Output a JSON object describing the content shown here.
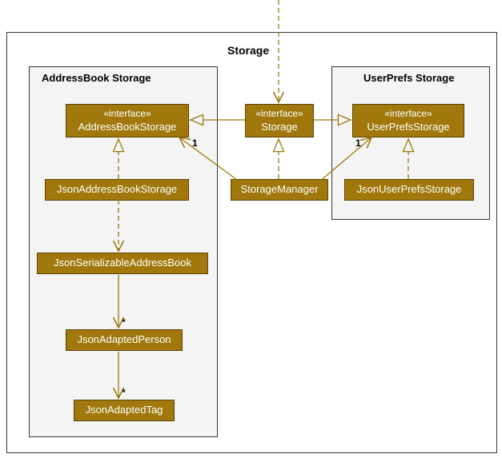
{
  "diagram": {
    "title": "Storage",
    "packages": {
      "addressbook": {
        "title": "AddressBook Storage"
      },
      "userprefs": {
        "title": "UserPrefs Storage"
      }
    },
    "classes": {
      "storage_iface": {
        "stereotype": "«interface»",
        "name": "Storage"
      },
      "abs_iface": {
        "stereotype": "«interface»",
        "name": "AddressBookStorage"
      },
      "ups_iface": {
        "stereotype": "«interface»",
        "name": "UserPrefsStorage"
      },
      "storage_manager": {
        "name": "StorageManager"
      },
      "json_abs": {
        "name": "JsonAddressBookStorage"
      },
      "json_ups": {
        "name": "JsonUserPrefsStorage"
      },
      "json_ser_ab": {
        "name": "JsonSerializableAddressBook"
      },
      "json_person": {
        "name": "JsonAdaptedPerson"
      },
      "json_tag": {
        "name": "JsonAdaptedTag"
      }
    },
    "multiplicities": {
      "abs_one": "1",
      "ups_one": "1",
      "person_many": "*",
      "tag_many": "*"
    }
  },
  "chart_data": {
    "type": "uml_class_diagram",
    "packages": [
      {
        "name": "Storage",
        "contains": [
          "AddressBook Storage",
          "UserPrefs Storage",
          "Storage",
          "StorageManager"
        ]
      },
      {
        "name": "AddressBook Storage",
        "contains": [
          "AddressBookStorage",
          "JsonAddressBookStorage",
          "JsonSerializableAddressBook",
          "JsonAdaptedPerson",
          "JsonAdaptedTag"
        ]
      },
      {
        "name": "UserPrefs Storage",
        "contains": [
          "UserPrefsStorage",
          "JsonUserPrefsStorage"
        ]
      }
    ],
    "classifiers": [
      {
        "name": "Storage",
        "stereotype": "interface"
      },
      {
        "name": "AddressBookStorage",
        "stereotype": "interface"
      },
      {
        "name": "UserPrefsStorage",
        "stereotype": "interface"
      },
      {
        "name": "StorageManager",
        "stereotype": "class"
      },
      {
        "name": "JsonAddressBookStorage",
        "stereotype": "class"
      },
      {
        "name": "JsonUserPrefsStorage",
        "stereotype": "class"
      },
      {
        "name": "JsonSerializableAddressBook",
        "stereotype": "class"
      },
      {
        "name": "JsonAdaptedPerson",
        "stereotype": "class"
      },
      {
        "name": "JsonAdaptedTag",
        "stereotype": "class"
      }
    ],
    "relationships": [
      {
        "from": "Storage",
        "to": "AddressBookStorage",
        "type": "generalization"
      },
      {
        "from": "Storage",
        "to": "UserPrefsStorage",
        "type": "generalization"
      },
      {
        "from": "StorageManager",
        "to": "Storage",
        "type": "realization"
      },
      {
        "from": "JsonAddressBookStorage",
        "to": "AddressBookStorage",
        "type": "realization"
      },
      {
        "from": "JsonUserPrefsStorage",
        "to": "UserPrefsStorage",
        "type": "realization"
      },
      {
        "from": "StorageManager",
        "to": "AddressBookStorage",
        "type": "association",
        "multiplicity": "1"
      },
      {
        "from": "StorageManager",
        "to": "UserPrefsStorage",
        "type": "association",
        "multiplicity": "1"
      },
      {
        "from": "JsonAddressBookStorage",
        "to": "JsonSerializableAddressBook",
        "type": "dependency"
      },
      {
        "from": "JsonSerializableAddressBook",
        "to": "JsonAdaptedPerson",
        "type": "association",
        "multiplicity": "*"
      },
      {
        "from": "JsonAdaptedPerson",
        "to": "JsonAdaptedTag",
        "type": "association",
        "multiplicity": "*"
      },
      {
        "from": "(external)",
        "to": "Storage",
        "type": "dependency"
      }
    ]
  }
}
